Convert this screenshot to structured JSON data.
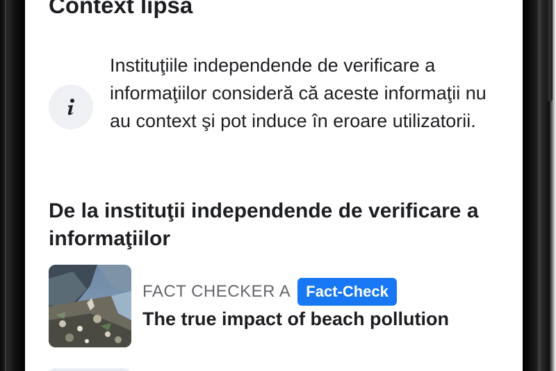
{
  "sheet": {
    "title": "Context lipsa",
    "info_text": "Instituţiile independende de verificare a informaţiilor consideră că aceste informaţii nu au context şi pot induce în eroare utilizatorii.",
    "info_icon": "info-icon"
  },
  "section": {
    "heading": "De la instituţii independende de verificare a informaţiilor"
  },
  "articles": [
    {
      "source": "FACT CHECKER A",
      "badge": "Fact-Check",
      "title": "The true impact of beach pollution",
      "thumbnail": "beach-pollution-photo"
    }
  ],
  "colors": {
    "badge_bg": "#1877f2",
    "text_primary": "#1c1e21",
    "text_secondary": "#65676b",
    "icon_circle": "#eef0f3"
  }
}
